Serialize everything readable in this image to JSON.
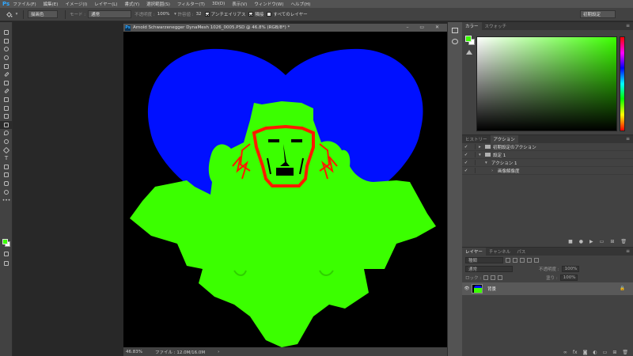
{
  "menubar": {
    "logo": "Ps",
    "items": [
      "ファイル(F)",
      "編集(E)",
      "イメージ(I)",
      "レイヤー(L)",
      "書式(Y)",
      "選択範囲(S)",
      "フィルター(T)",
      "3D(D)",
      "表示(V)",
      "ウィンドウ(W)",
      "ヘルプ(H)"
    ]
  },
  "options": {
    "brush_mode": "描画色",
    "mode_label": "モード :",
    "mode_value": "通常",
    "opacity_label": "不透明度 :",
    "opacity_value": "100%",
    "tolerance_label": "許容値 :",
    "tolerance_value": "32",
    "antialias_label": "アンチエイリアス",
    "contiguous_label": "隣接",
    "all_layers_label": "すべてのレイヤー",
    "workspace": "初期設定"
  },
  "document": {
    "tab_title": "Arnold Schwarzenegger DynaMesh 1026_0005.PSD @ 46.8% (RGB/8*) *",
    "zoom": "46.83%",
    "file_info": "ファイル : 12.0M/16.0M"
  },
  "color_panel": {
    "tabs": [
      "カラー",
      "スウォッチ"
    ],
    "foreground": "#3bff00",
    "background": "#ffffff"
  },
  "actions_panel": {
    "tabs": [
      "ヒストリー",
      "アクション"
    ],
    "rows": [
      {
        "label": "初期設定のアクション",
        "level": 0
      },
      {
        "label": "設定 1",
        "level": 0
      },
      {
        "label": "アクション 1",
        "level": 1
      },
      {
        "label": "画像解像度",
        "level": 2
      }
    ]
  },
  "layers_panel": {
    "tabs": [
      "レイヤー",
      "チャンネル",
      "パス"
    ],
    "filter_kind": "種類",
    "blend_mode": "通常",
    "opacity_label": "不透明度 :",
    "opacity_value": "100%",
    "lock_label": "ロック :",
    "fill_label": "塗り :",
    "fill_value": "100%",
    "layers": [
      {
        "name": "背景"
      }
    ]
  },
  "canvas_colors": {
    "blue": "#0010ff",
    "green": "#3bff00",
    "red": "#ff1a00",
    "black": "#000000"
  }
}
